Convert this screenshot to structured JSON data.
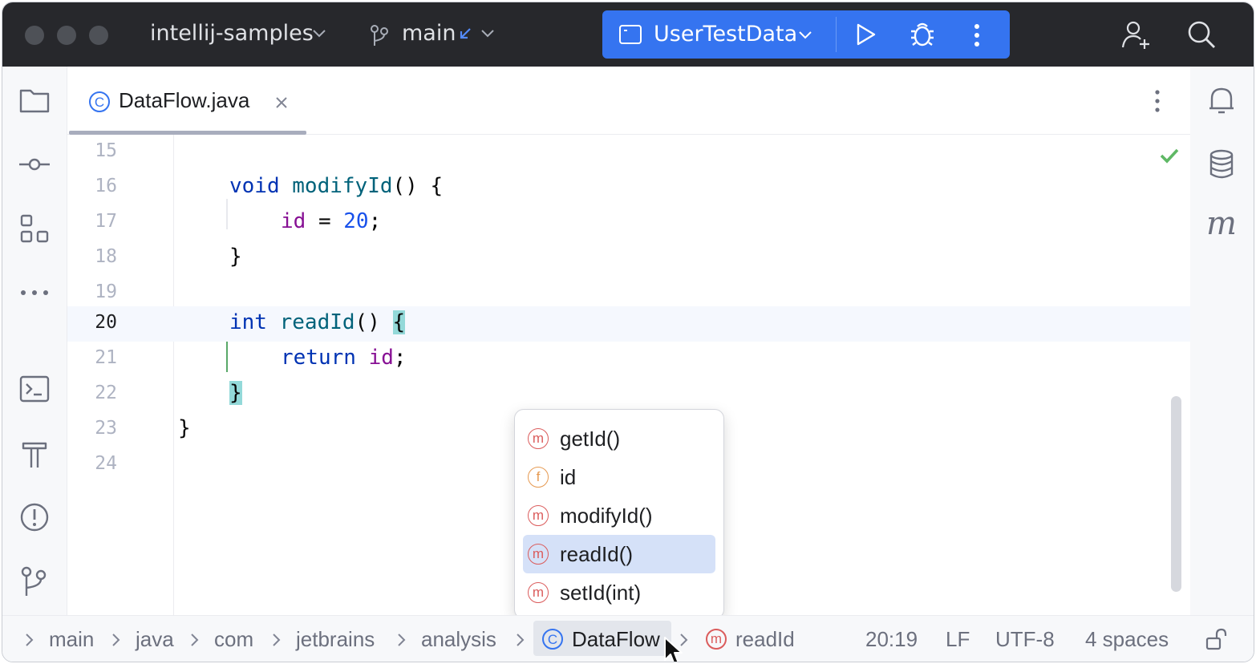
{
  "titlebar": {
    "project": "intellij-samples",
    "branch": "main",
    "run_config": "UserTestData",
    "accent": "#3574f0"
  },
  "left_toolbar": [
    "folder-icon",
    "commit-icon",
    "structure-icon",
    "more-icon",
    "terminal-icon",
    "build-hammer-icon",
    "problems-icon",
    "git-branch-icon"
  ],
  "right_toolbar": [
    "notifications-icon",
    "database-icon",
    "maven-icon"
  ],
  "tab": {
    "file": "DataFlow.java",
    "icon": "class-icon"
  },
  "editor": {
    "lines": [
      {
        "n": "15"
      },
      {
        "n": "16"
      },
      {
        "n": "17"
      },
      {
        "n": "18"
      },
      {
        "n": "19"
      },
      {
        "n": "20"
      },
      {
        "n": "21"
      },
      {
        "n": "22"
      },
      {
        "n": "23"
      },
      {
        "n": "24"
      }
    ],
    "code": {
      "l16": {
        "kw": "void",
        "fn": "modifyId",
        "rest": "() {"
      },
      "l17": {
        "fld": "id",
        "op": " = ",
        "num": "20",
        "end": ";"
      },
      "l18": "}",
      "l20": {
        "kw": "int",
        "fn": "readId",
        "rest": "() ",
        "brace": "{"
      },
      "l21": {
        "kw": "return",
        "fld": "id",
        "end": ";"
      },
      "l22": "}",
      "l23": "}"
    },
    "current_line": "20"
  },
  "popup": {
    "items": [
      {
        "kind": "m",
        "label": "getId()"
      },
      {
        "kind": "f",
        "label": "id"
      },
      {
        "kind": "m",
        "label": "modifyId()"
      },
      {
        "kind": "m",
        "label": "readId()",
        "selected": true
      },
      {
        "kind": "m",
        "label": "setId(int)"
      }
    ]
  },
  "statusbar": {
    "breadcrumbs": [
      "main",
      "java",
      "com",
      "jetbrains",
      "analysis"
    ],
    "class_crumb": "DataFlow",
    "method_crumb": "readId",
    "position": "20:19",
    "line_sep": "LF",
    "encoding": "UTF-8",
    "indent": "4 spaces"
  }
}
